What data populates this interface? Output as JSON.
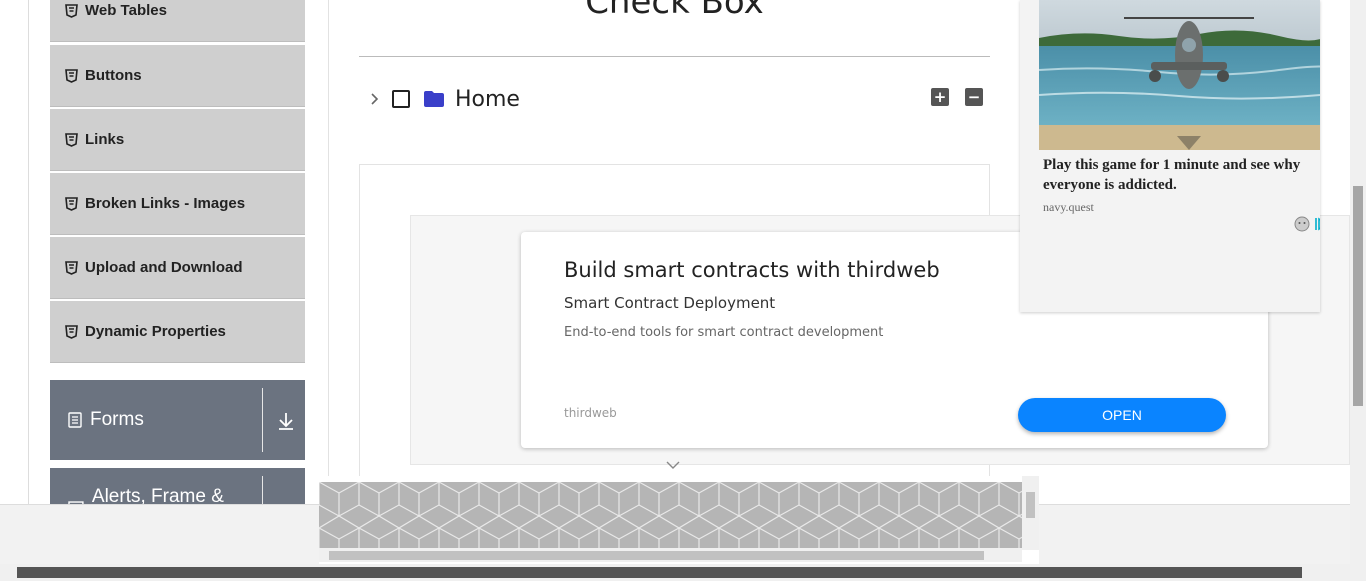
{
  "sidebar": {
    "items": [
      {
        "label": "Web Tables"
      },
      {
        "label": "Buttons"
      },
      {
        "label": "Links"
      },
      {
        "label": "Broken Links - Images"
      },
      {
        "label": "Upload and Download"
      },
      {
        "label": "Dynamic Properties"
      }
    ],
    "sections": [
      {
        "label": "Forms"
      },
      {
        "label": "Alerts, Frame & Windows"
      }
    ]
  },
  "main": {
    "title": "Check Box",
    "tree": {
      "root_label": "Home",
      "expand_all": "+",
      "collapse_all": "−"
    }
  },
  "ad_main": {
    "headline": "Build smart contracts with thirdweb",
    "subheadline": "Smart Contract Deployment",
    "description": "End-to-end tools for smart contract development",
    "brand": "thirdweb",
    "cta": "OPEN"
  },
  "ad_side": {
    "title": "Play this game for 1 minute and see why everyone is addicted.",
    "source": "navy.quest"
  },
  "colors": {
    "sidebar_item_bg": "#cfcfcf",
    "section_bg": "#6b7380",
    "folder": "#3a3fc9",
    "cta": "#0a84ff"
  }
}
